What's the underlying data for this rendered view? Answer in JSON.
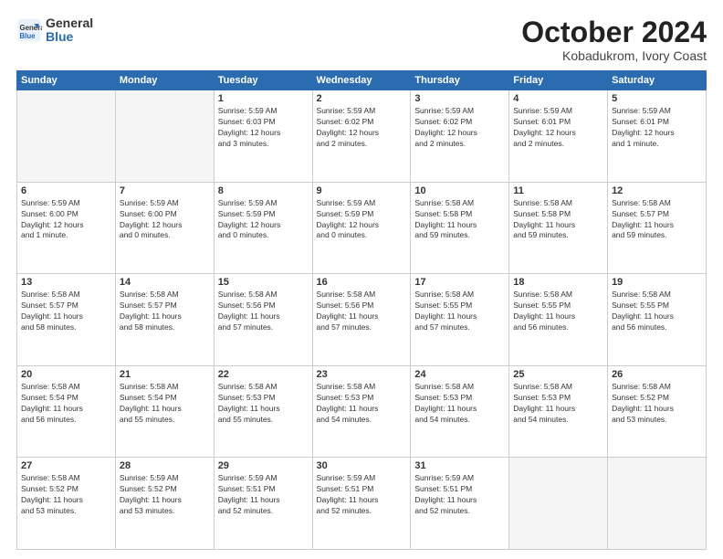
{
  "logo": {
    "general": "General",
    "blue": "Blue"
  },
  "header": {
    "title": "October 2024",
    "subtitle": "Kobadukrom, Ivory Coast"
  },
  "days_of_week": [
    "Sunday",
    "Monday",
    "Tuesday",
    "Wednesday",
    "Thursday",
    "Friday",
    "Saturday"
  ],
  "weeks": [
    [
      {
        "day": "",
        "info": ""
      },
      {
        "day": "",
        "info": ""
      },
      {
        "day": "1",
        "info": "Sunrise: 5:59 AM\nSunset: 6:03 PM\nDaylight: 12 hours\nand 3 minutes."
      },
      {
        "day": "2",
        "info": "Sunrise: 5:59 AM\nSunset: 6:02 PM\nDaylight: 12 hours\nand 2 minutes."
      },
      {
        "day": "3",
        "info": "Sunrise: 5:59 AM\nSunset: 6:02 PM\nDaylight: 12 hours\nand 2 minutes."
      },
      {
        "day": "4",
        "info": "Sunrise: 5:59 AM\nSunset: 6:01 PM\nDaylight: 12 hours\nand 2 minutes."
      },
      {
        "day": "5",
        "info": "Sunrise: 5:59 AM\nSunset: 6:01 PM\nDaylight: 12 hours\nand 1 minute."
      }
    ],
    [
      {
        "day": "6",
        "info": "Sunrise: 5:59 AM\nSunset: 6:00 PM\nDaylight: 12 hours\nand 1 minute."
      },
      {
        "day": "7",
        "info": "Sunrise: 5:59 AM\nSunset: 6:00 PM\nDaylight: 12 hours\nand 0 minutes."
      },
      {
        "day": "8",
        "info": "Sunrise: 5:59 AM\nSunset: 5:59 PM\nDaylight: 12 hours\nand 0 minutes."
      },
      {
        "day": "9",
        "info": "Sunrise: 5:59 AM\nSunset: 5:59 PM\nDaylight: 12 hours\nand 0 minutes."
      },
      {
        "day": "10",
        "info": "Sunrise: 5:58 AM\nSunset: 5:58 PM\nDaylight: 11 hours\nand 59 minutes."
      },
      {
        "day": "11",
        "info": "Sunrise: 5:58 AM\nSunset: 5:58 PM\nDaylight: 11 hours\nand 59 minutes."
      },
      {
        "day": "12",
        "info": "Sunrise: 5:58 AM\nSunset: 5:57 PM\nDaylight: 11 hours\nand 59 minutes."
      }
    ],
    [
      {
        "day": "13",
        "info": "Sunrise: 5:58 AM\nSunset: 5:57 PM\nDaylight: 11 hours\nand 58 minutes."
      },
      {
        "day": "14",
        "info": "Sunrise: 5:58 AM\nSunset: 5:57 PM\nDaylight: 11 hours\nand 58 minutes."
      },
      {
        "day": "15",
        "info": "Sunrise: 5:58 AM\nSunset: 5:56 PM\nDaylight: 11 hours\nand 57 minutes."
      },
      {
        "day": "16",
        "info": "Sunrise: 5:58 AM\nSunset: 5:56 PM\nDaylight: 11 hours\nand 57 minutes."
      },
      {
        "day": "17",
        "info": "Sunrise: 5:58 AM\nSunset: 5:55 PM\nDaylight: 11 hours\nand 57 minutes."
      },
      {
        "day": "18",
        "info": "Sunrise: 5:58 AM\nSunset: 5:55 PM\nDaylight: 11 hours\nand 56 minutes."
      },
      {
        "day": "19",
        "info": "Sunrise: 5:58 AM\nSunset: 5:55 PM\nDaylight: 11 hours\nand 56 minutes."
      }
    ],
    [
      {
        "day": "20",
        "info": "Sunrise: 5:58 AM\nSunset: 5:54 PM\nDaylight: 11 hours\nand 56 minutes."
      },
      {
        "day": "21",
        "info": "Sunrise: 5:58 AM\nSunset: 5:54 PM\nDaylight: 11 hours\nand 55 minutes."
      },
      {
        "day": "22",
        "info": "Sunrise: 5:58 AM\nSunset: 5:53 PM\nDaylight: 11 hours\nand 55 minutes."
      },
      {
        "day": "23",
        "info": "Sunrise: 5:58 AM\nSunset: 5:53 PM\nDaylight: 11 hours\nand 54 minutes."
      },
      {
        "day": "24",
        "info": "Sunrise: 5:58 AM\nSunset: 5:53 PM\nDaylight: 11 hours\nand 54 minutes."
      },
      {
        "day": "25",
        "info": "Sunrise: 5:58 AM\nSunset: 5:53 PM\nDaylight: 11 hours\nand 54 minutes."
      },
      {
        "day": "26",
        "info": "Sunrise: 5:58 AM\nSunset: 5:52 PM\nDaylight: 11 hours\nand 53 minutes."
      }
    ],
    [
      {
        "day": "27",
        "info": "Sunrise: 5:58 AM\nSunset: 5:52 PM\nDaylight: 11 hours\nand 53 minutes."
      },
      {
        "day": "28",
        "info": "Sunrise: 5:59 AM\nSunset: 5:52 PM\nDaylight: 11 hours\nand 53 minutes."
      },
      {
        "day": "29",
        "info": "Sunrise: 5:59 AM\nSunset: 5:51 PM\nDaylight: 11 hours\nand 52 minutes."
      },
      {
        "day": "30",
        "info": "Sunrise: 5:59 AM\nSunset: 5:51 PM\nDaylight: 11 hours\nand 52 minutes."
      },
      {
        "day": "31",
        "info": "Sunrise: 5:59 AM\nSunset: 5:51 PM\nDaylight: 11 hours\nand 52 minutes."
      },
      {
        "day": "",
        "info": ""
      },
      {
        "day": "",
        "info": ""
      }
    ]
  ]
}
